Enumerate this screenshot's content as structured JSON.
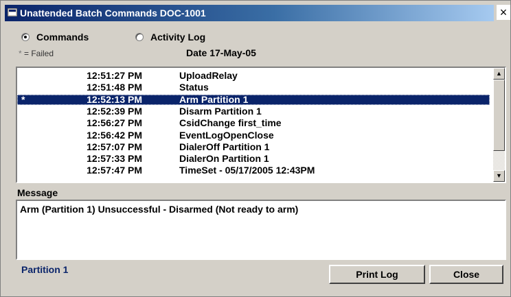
{
  "window": {
    "title": "Unattended Batch Commands DOC-1001",
    "close_label": "×"
  },
  "view_options": {
    "commands_label": "Commands",
    "activity_log_label": "Activity Log",
    "selected": "Commands"
  },
  "legend": {
    "star": "*",
    "text": " = Failed"
  },
  "date_label": "Date 17-May-05",
  "commands": [
    {
      "failed": "",
      "time": "12:51:27 PM",
      "command": "UploadRelay"
    },
    {
      "failed": "",
      "time": "12:51:48 PM",
      "command": "Status"
    },
    {
      "failed": "*",
      "time": "12:52:13 PM",
      "command": "Arm Partition 1",
      "selected": true
    },
    {
      "failed": "",
      "time": "12:52:39 PM",
      "command": "Disarm Partition 1"
    },
    {
      "failed": "",
      "time": "12:56:27 PM",
      "command": "CsidChange first_time"
    },
    {
      "failed": "",
      "time": "12:56:42 PM",
      "command": "EventLogOpenClose"
    },
    {
      "failed": "",
      "time": "12:57:07 PM",
      "command": "DialerOff Partition 1"
    },
    {
      "failed": "",
      "time": "12:57:33 PM",
      "command": "DialerOn Partition 1"
    },
    {
      "failed": "",
      "time": "12:57:47 PM",
      "command": "TimeSet  -  05/17/2005  12:43PM"
    }
  ],
  "message": {
    "label": "Message",
    "text": "Arm (Partition 1) Unsuccessful -  Disarmed (Not ready to arm)"
  },
  "partition_label": "Partition 1",
  "buttons": {
    "print_log": "Print Log",
    "close": "Close"
  },
  "icons": {
    "system": "window-system-icon",
    "scroll_up": "▲",
    "scroll_down": "▼"
  },
  "colors": {
    "title_start": "#0a246a",
    "title_end": "#a6caf0",
    "selection": "#0a246a",
    "partition_text": "#0a246a"
  }
}
